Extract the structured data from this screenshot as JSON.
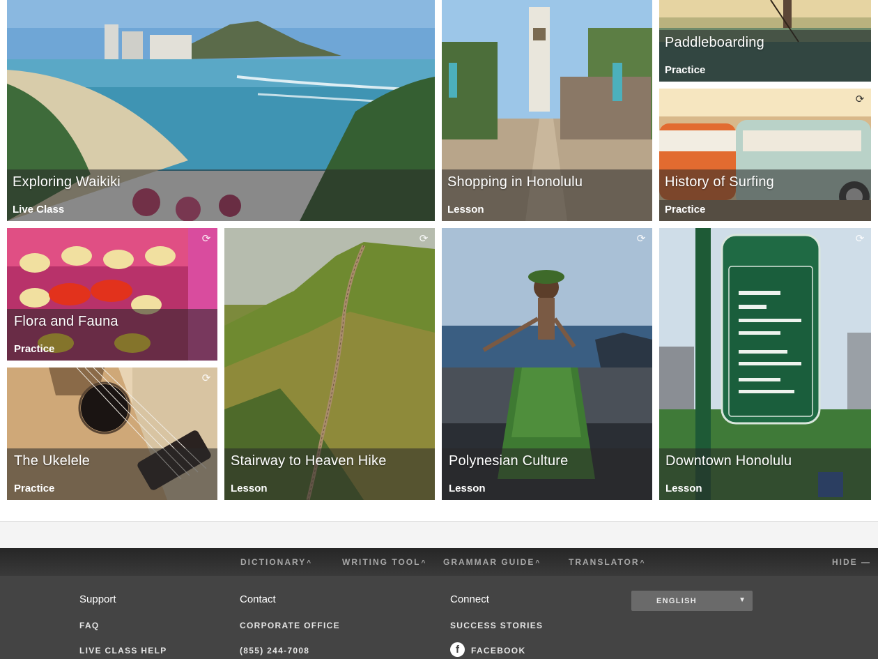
{
  "tiles": [
    {
      "title": "Exploring Waikiki",
      "kind": "Live Class",
      "icon": "",
      "colors": [
        "#5aa0c8",
        "#2f7a8e",
        "#5e8a48"
      ]
    },
    {
      "title": "Shopping in Honolulu",
      "kind": "Lesson",
      "icon": "",
      "colors": [
        "#8fb9de",
        "#6b8d5a",
        "#b8a78e"
      ]
    },
    {
      "title": "Paddleboarding",
      "kind": "Practice",
      "icon": "",
      "colors": [
        "#d7c79b",
        "#6d8a6c",
        "#3d6a60"
      ]
    },
    {
      "title": "History of Surfing",
      "kind": "Practice",
      "icon": "refresh-icon",
      "colors": [
        "#f2d9a8",
        "#e07238",
        "#9fb9b0"
      ]
    },
    {
      "title": "Flora and Fauna",
      "kind": "Practice",
      "icon": "refresh-icon",
      "colors": [
        "#e8d28a",
        "#d63a68",
        "#c43220"
      ]
    },
    {
      "title": "Stairway to Heaven Hike",
      "kind": "Lesson",
      "icon": "refresh-icon",
      "colors": [
        "#b9bdb1",
        "#7a8a3a",
        "#445a22"
      ]
    },
    {
      "title": "Polynesian Culture",
      "kind": "Lesson",
      "icon": "refresh-icon",
      "colors": [
        "#9db4cc",
        "#3d5f7e",
        "#2f5a2a"
      ]
    },
    {
      "title": "Downtown Honolulu",
      "kind": "Lesson",
      "icon": "refresh-icon",
      "colors": [
        "#c9d9e6",
        "#1f6a44",
        "#3e7a3a"
      ]
    },
    {
      "title": "The Ukelele",
      "kind": "Practice",
      "icon": "refresh-icon",
      "colors": [
        "#e6d2b4",
        "#c9a478",
        "#2a2420"
      ]
    }
  ],
  "toolbar": {
    "dictionary": "DICTIONARY",
    "writing_tool": "WRITING TOOL",
    "grammar_guide": "GRAMMAR GUIDE",
    "translator": "TRANSLATOR",
    "hide": "HIDE"
  },
  "footer": {
    "support": {
      "heading": "Support",
      "links": [
        "FAQ",
        "LIVE CLASS HELP"
      ]
    },
    "contact": {
      "heading": "Contact",
      "links": [
        "CORPORATE OFFICE",
        "(855) 244-7008"
      ]
    },
    "connect": {
      "heading": "Connect",
      "links": [
        "SUCCESS STORIES",
        "FACEBOOK"
      ]
    },
    "language": {
      "selected": "ENGLISH"
    }
  }
}
